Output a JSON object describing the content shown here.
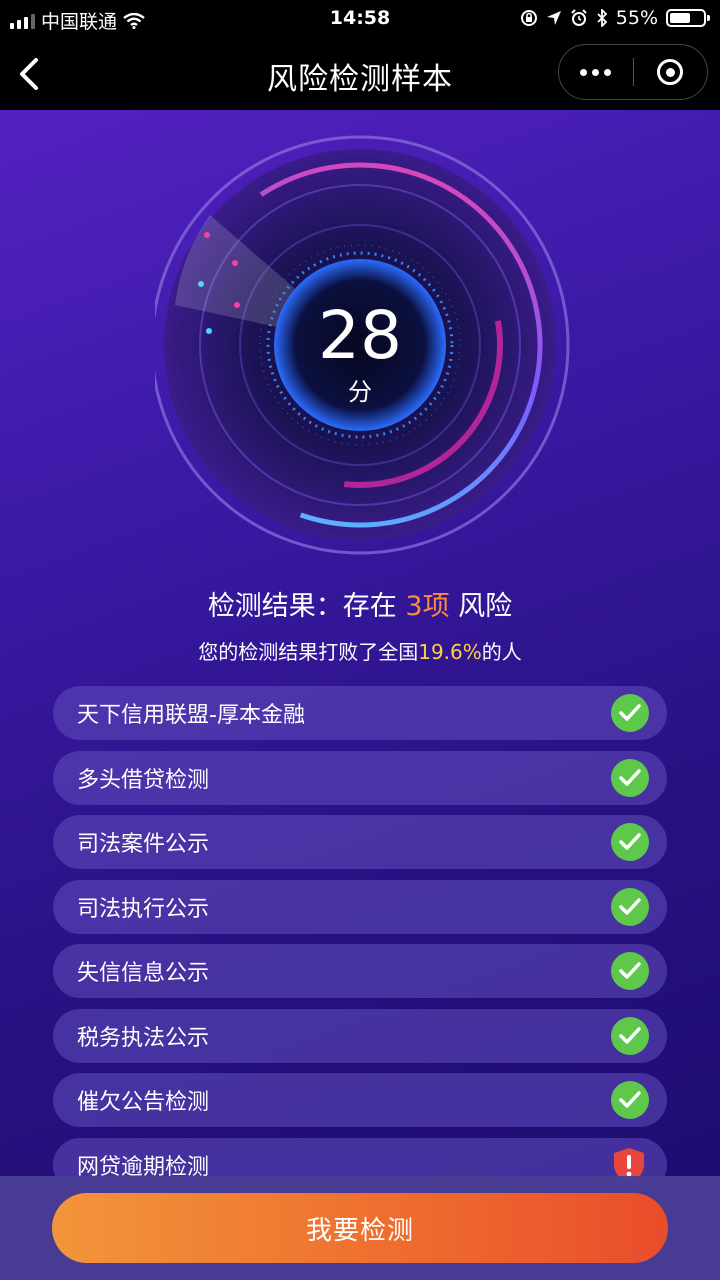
{
  "status_bar": {
    "carrier": "中国联通",
    "time": "14:58",
    "battery": "55%"
  },
  "nav": {
    "title": "风险检测样本"
  },
  "gauge": {
    "score": "28",
    "unit": "分"
  },
  "result": {
    "prefix": "检测结果：存在 ",
    "count": "3项",
    "suffix": " 风险"
  },
  "summary": {
    "prefix": "您的检测结果打败了全国",
    "percent": "19.6%",
    "suffix": "的人"
  },
  "checks": [
    {
      "label": "天下信用联盟-厚本金融",
      "status": "pass"
    },
    {
      "label": "多头借贷检测",
      "status": "pass"
    },
    {
      "label": "司法案件公示",
      "status": "pass"
    },
    {
      "label": "司法执行公示",
      "status": "pass"
    },
    {
      "label": "失信信息公示",
      "status": "pass"
    },
    {
      "label": "税务执法公示",
      "status": "pass"
    },
    {
      "label": "催欠公告检测",
      "status": "pass"
    },
    {
      "label": "网贷逾期检测",
      "status": "warn"
    }
  ],
  "cta": {
    "label": "我要检测"
  },
  "colors": {
    "highlight_orange": "#ff8a3d",
    "highlight_yellow": "#ffcf3f",
    "pass_green": "#5dc84a",
    "warn_red": "#e8453c"
  }
}
